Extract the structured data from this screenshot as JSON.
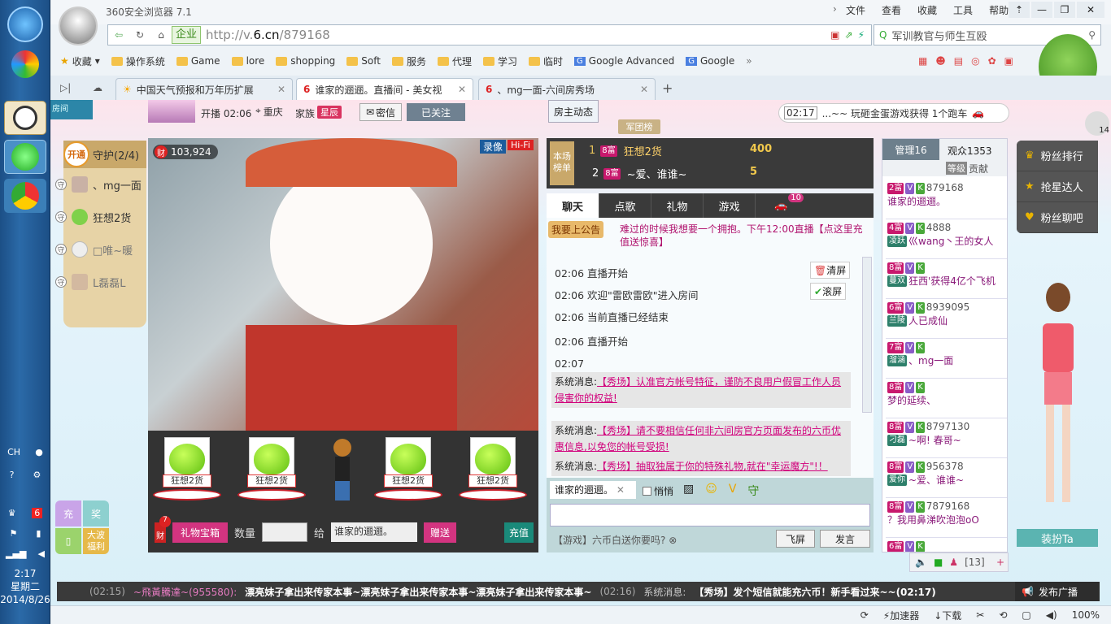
{
  "taskbar": {
    "lang": "CH",
    "time": "2:17",
    "weekday": "星期二",
    "date": "2014/8/26"
  },
  "browser": {
    "title": "360安全浏览器 7.1",
    "menus": [
      "文件",
      "查看",
      "收藏",
      "工具",
      "帮助"
    ],
    "company_btn": "企业",
    "url_prefix": "http://v.",
    "url_host": "6.cn",
    "url_path": "/879168",
    "search_text": "军训教官与师生互殴",
    "favorites_label": "收藏",
    "favorites": [
      "操作系统",
      "Game",
      "lore",
      "shopping",
      "Soft",
      "服务",
      "代理",
      "学习",
      "临时",
      "Google Advanced",
      "Google"
    ],
    "tabs": [
      {
        "title": "中国天气预报和万年历扩展"
      },
      {
        "title": "谁家的逦逦。直播间 - 美女视"
      },
      {
        "title": "、mg一面-六间房秀场"
      }
    ]
  },
  "room": {
    "status_text": "开播 02:06",
    "location": "重庆",
    "family_label": "家族",
    "family_name": "星辰",
    "private_msg": "密信",
    "follow": "已关注",
    "host_news": "房主动态",
    "army": "军团榜",
    "ticker_time": "02:17",
    "ticker_text": "...~~ 玩砸金蛋游戏获得 1个跑车",
    "ticker_count": "14",
    "wealth": "103,924",
    "record": "录像",
    "hifi": "Hi-Fi",
    "guard_open": "开通",
    "guard_title": "守护(2/4)",
    "guards": [
      {
        "name": "、mg一面"
      },
      {
        "name": "狂想2货"
      },
      {
        "name": "□唯~暖"
      },
      {
        "name": "L磊磊L"
      }
    ],
    "gift_names": [
      "狂想2货",
      "狂想2货",
      "狂想2货",
      "狂想2货"
    ],
    "giftbar": {
      "count_badge": "7",
      "wealth_label": "财",
      "box": "礼物宝箱",
      "qty_label": "数量",
      "to_label": "给",
      "to_name": "谁家的逦逦。",
      "send": "赠送",
      "recharge": "充值"
    },
    "left_promos": {
      "a": "充",
      "b": "奖",
      "c": "大波福利"
    }
  },
  "rank": {
    "title_a": "本场",
    "title_b": "榜单",
    "rows": [
      {
        "num": "1",
        "level": "8富",
        "name": "狂想2货",
        "score": "400"
      },
      {
        "num": "2",
        "level": "8富",
        "name": "~爱、谁谁~",
        "score": "5"
      }
    ]
  },
  "chat": {
    "tabs": [
      "聊天",
      "点歌",
      "礼物",
      "游戏",
      ""
    ],
    "car_count": "10",
    "notice_label": "我要上公告",
    "notice": "难过的时候我想要一个拥抱。下午12:00直播【点这里充值送惊喜】",
    "clear": "清屏",
    "scroll": "滚屏",
    "lines": [
      {
        "t": "02:06",
        "m": "直播开始"
      },
      {
        "t": "02:06",
        "m": "欢迎\"雷欧雷欧\"进入房间"
      },
      {
        "t": "02:06",
        "m": "当前直播已经结束"
      },
      {
        "t": "02:06",
        "m": "直播开始"
      },
      {
        "t": "02:07",
        "m": ""
      }
    ],
    "sys": [
      {
        "p": "系统消息:",
        "h": "【秀场】认准官方帐号特征，谨防不良用户假冒工作人员侵害你的权益!"
      },
      {
        "p": "系统消息:",
        "h": "【秀场】请不要相信任何非六间房官方页面发布的六币优惠信息,以免您的帐号受损!"
      },
      {
        "p": "系统消息:",
        "h": "【秀场】抽取独属于你的特殊礼物,就在\"幸运魔方\"!！"
      }
    ],
    "target": "谁家的逦逦。",
    "whisper": "悄悄",
    "send_fly": "飞屏",
    "send": "发言",
    "tip": "【游戏】六币白送你要吗?"
  },
  "audience": {
    "manage": "管理16",
    "watchers": "观众1353",
    "grade": "等级",
    "contrib": "贡献",
    "users": [
      {
        "lv": "2富",
        "id": "879168",
        "name": "谁家的逦逦。"
      },
      {
        "lv": "4富",
        "id": "4888",
        "tag": "凌跃",
        "name": "巛wang丶王的女人"
      },
      {
        "lv": "8富",
        "id": "",
        "tag": "蔓双",
        "name": "狂西'获得4亿个飞机"
      },
      {
        "lv": "6富",
        "id": "8939095",
        "tag": "兰陵",
        "name": "人已成仙"
      },
      {
        "lv": "7富",
        "id": "",
        "tag": "溜涵",
        "name": "、mg一面"
      },
      {
        "lv": "8富",
        "id": "",
        "name": "梦的延续、"
      },
      {
        "lv": "8富",
        "id": "8797130",
        "tag": "刁磊",
        "name": "~啊! 春哥~"
      },
      {
        "lv": "8富",
        "id": "956378",
        "tag": "爱你",
        "name": "~爱、谁谁~"
      },
      {
        "lv": "8富",
        "id": "7879168",
        "name": "？我用鼻涕吹泡泡oO"
      },
      {
        "lv": "6富",
        "id": "",
        "name": ""
      }
    ],
    "bottom_count": "[13]"
  },
  "side": {
    "fan_rank": "粉丝排行",
    "star": "抢星达人",
    "fan_bar": "粉丝聊吧",
    "dress": "装扮Ta"
  },
  "broadcast": {
    "time1": "(02:15)",
    "user": "~飛黃騰達~(955580):",
    "msg": "漂亮妹子拿出来传家本事~漂亮妹子拿出来传家本事~漂亮妹子拿出来传家本事~",
    "time2": "(02:16)",
    "sys_label": "系统消息:",
    "sys": "【秀场】发个短信就能充六币！新手看过来~~(02:17)",
    "publish": "发布广播"
  },
  "status": {
    "accel": "加速器",
    "download": "下载",
    "zoom": "100%"
  }
}
